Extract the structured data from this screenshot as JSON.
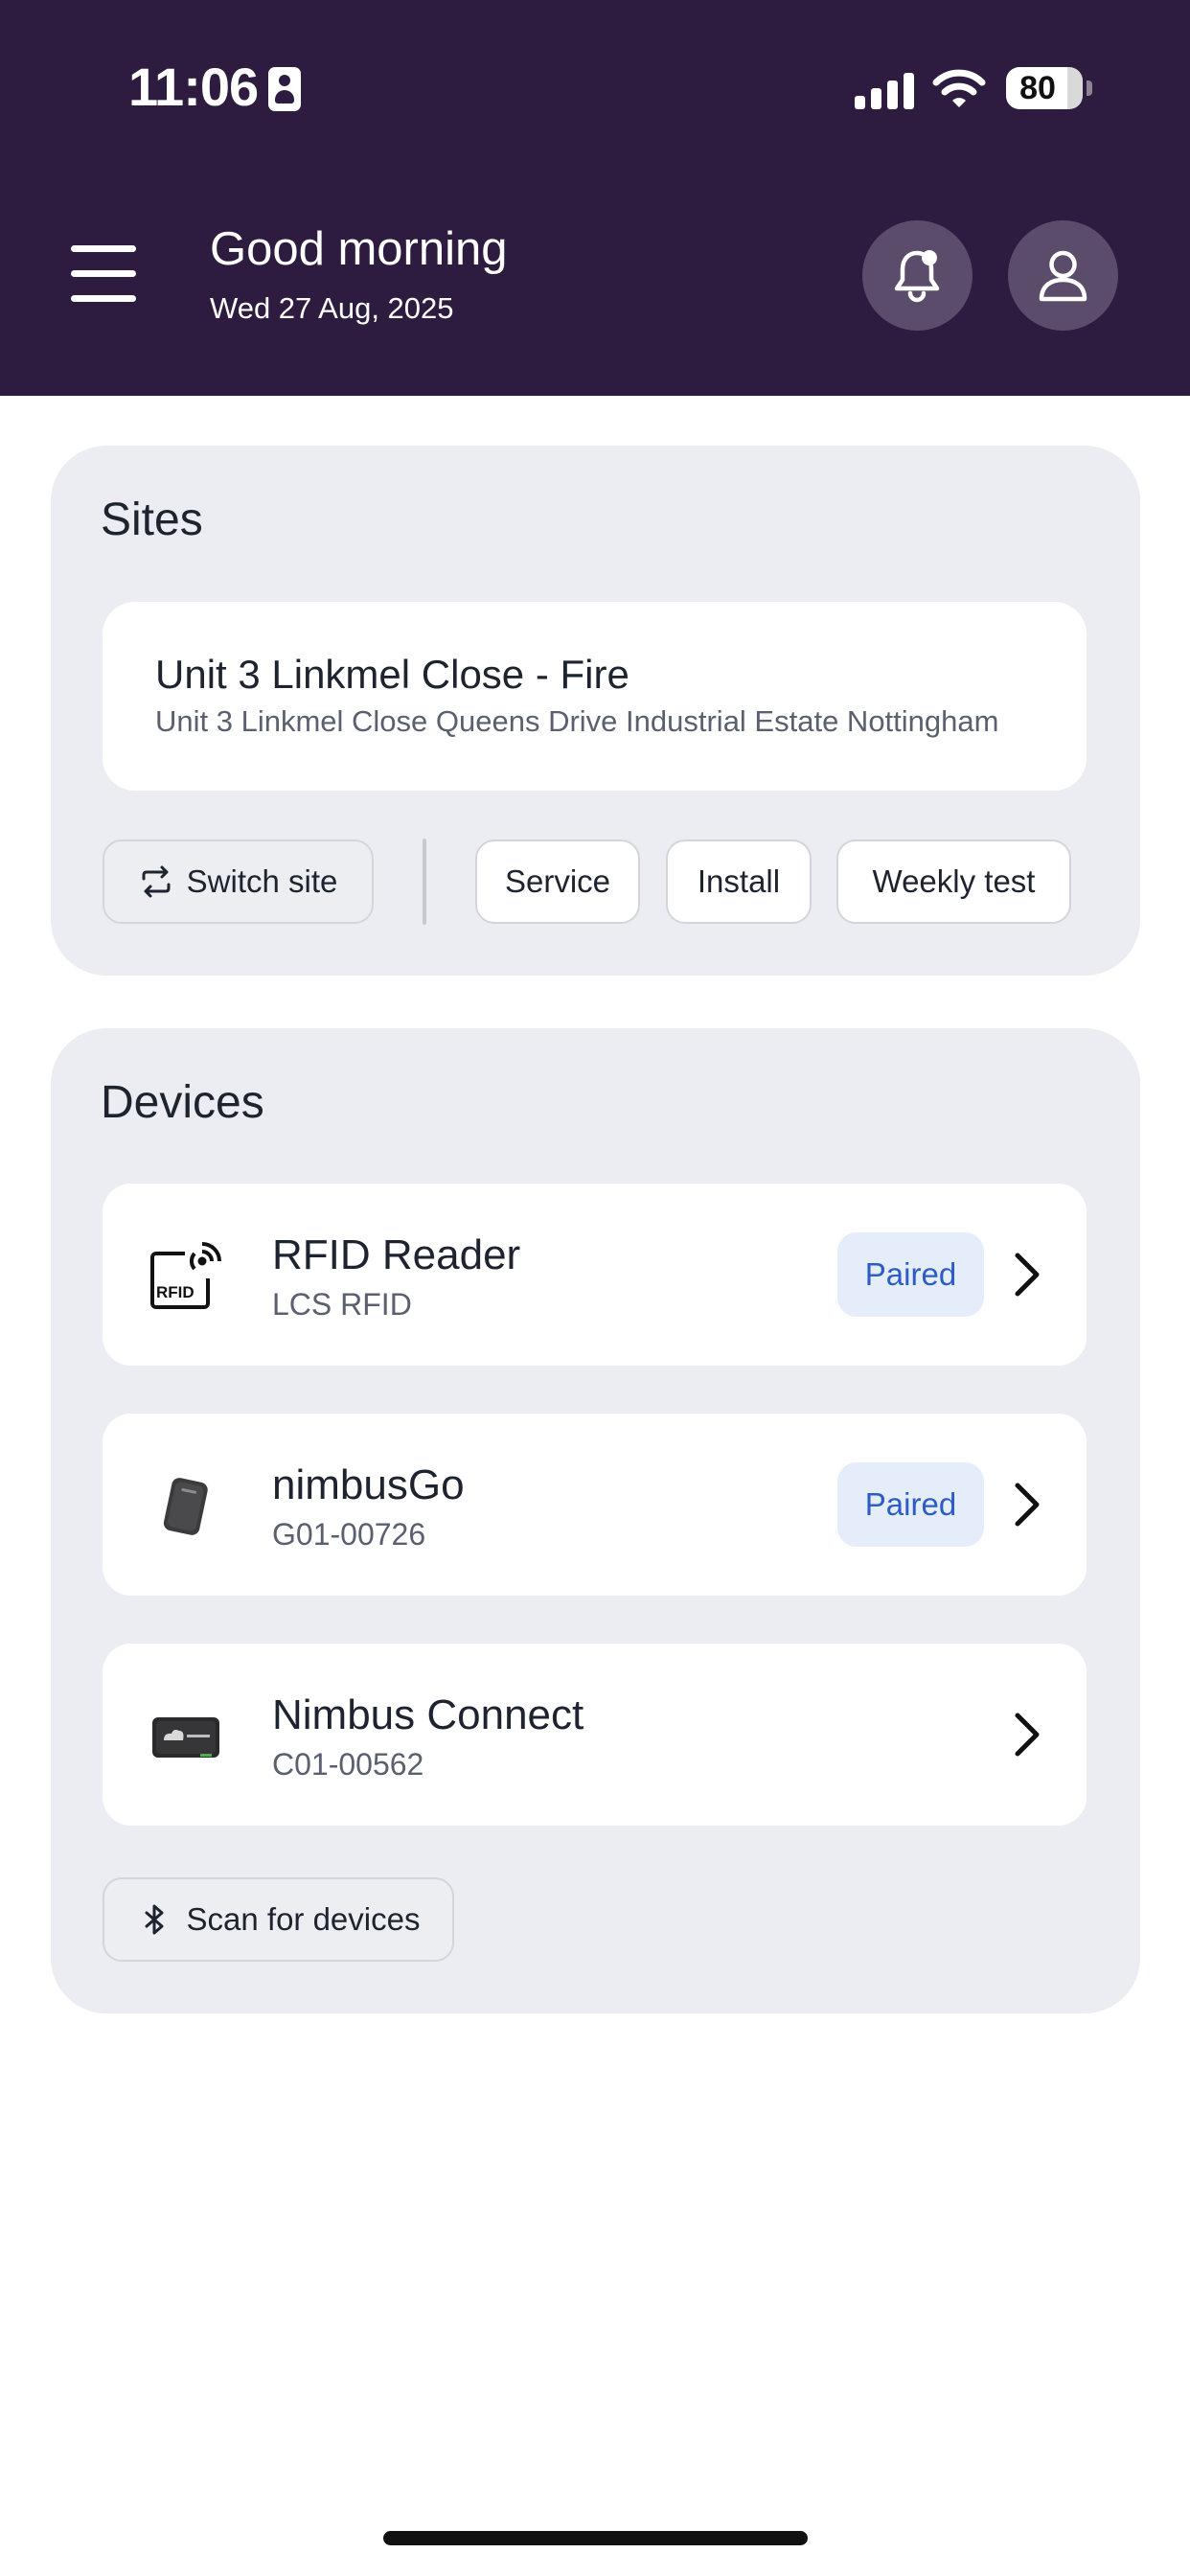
{
  "status_bar": {
    "time": "11:06",
    "battery": "80",
    "battery_level": 0.8,
    "icons": [
      "contact-card-icon",
      "cellular-signal-icon",
      "wifi-icon",
      "battery-icon"
    ]
  },
  "header": {
    "menu_icon": "hamburger-menu-icon",
    "greeting": "Good morning",
    "date": "Wed 27 Aug, 2025",
    "notification_icon": "bell-notification-icon",
    "profile_icon": "user-profile-icon",
    "background_color": "#2d1c3f"
  },
  "sites": {
    "title": "Sites",
    "current_site": {
      "name": "Unit 3 Linkmel Close - Fire",
      "address": "Unit 3 Linkmel Close Queens Drive Industrial Estate Nottingham"
    },
    "switch_label": "Switch site",
    "switch_icon": "swap-arrows-icon",
    "actions": [
      {
        "label": "Service"
      },
      {
        "label": "Install"
      },
      {
        "label": "Weekly test"
      }
    ]
  },
  "devices": {
    "title": "Devices",
    "items": [
      {
        "name": "RFID Reader",
        "id": "LCS RFID",
        "status": "Paired",
        "icon": "rfid-reader-icon"
      },
      {
        "name": "nimbusGo",
        "id": "G01-00726",
        "status": "Paired",
        "icon": "nimbusgo-device-icon"
      },
      {
        "name": "Nimbus Connect",
        "id": "C01-00562",
        "status": "",
        "icon": "nimbus-connect-device-icon"
      }
    ],
    "scan_label": "Scan for devices",
    "scan_icon": "bluetooth-icon"
  },
  "colors": {
    "header_bg": "#2d1c3f",
    "card_bg": "#ecedf2",
    "badge_bg": "#e5ecfa",
    "badge_text": "#2c5cc5",
    "text_primary": "#1e2330",
    "text_secondary": "#5a6070"
  }
}
